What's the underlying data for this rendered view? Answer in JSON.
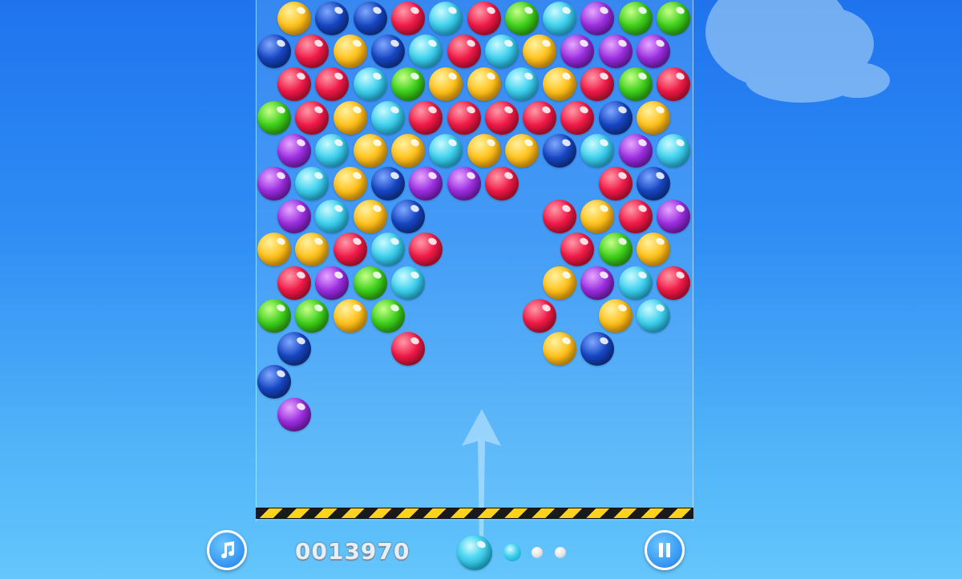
{
  "game": {
    "score": "0013970",
    "music_button_icon": "music-note-icon",
    "pause_button_icon": "pause-icon",
    "next_queue": [
      "cyan",
      "white",
      "white"
    ],
    "current_bubble": "cyan"
  },
  "colors": {
    "yellow": [
      "#fff2a0",
      "#ffc21e",
      "#d98a00"
    ],
    "navy": [
      "#7fa9ff",
      "#1746c4",
      "#0b2a7a"
    ],
    "red": [
      "#ff9aa8",
      "#f01a47",
      "#a80a28"
    ],
    "cyan": [
      "#c9fbff",
      "#3ed0ee",
      "#0e93bd"
    ],
    "green": [
      "#c8ff8a",
      "#3ed01c",
      "#1f8a0a"
    ],
    "purple": [
      "#e7a8ff",
      "#9b2ee0",
      "#5e1196"
    ],
    "white": [
      "#ffffff",
      "#e3e3e3",
      "#a9a9a9"
    ]
  },
  "grid": {
    "rows": [
      [
        "yellow",
        "navy",
        "navy",
        "red",
        "cyan",
        "red",
        "green",
        "cyan",
        "purple",
        "green",
        "green"
      ],
      [
        "navy",
        "red",
        "yellow",
        "navy",
        "cyan",
        "red",
        "cyan",
        "yellow",
        "purple",
        "purple",
        "purple"
      ],
      [
        "red",
        "red",
        "cyan",
        "green",
        "yellow",
        "yellow",
        "cyan",
        "yellow",
        "red",
        "green",
        "red"
      ],
      [
        "green",
        "red",
        "yellow",
        "cyan",
        "red",
        "red",
        "red",
        "red",
        "red",
        "navy",
        "yellow"
      ],
      [
        "purple",
        "cyan",
        "yellow",
        "yellow",
        "cyan",
        "yellow",
        "yellow",
        "navy",
        "cyan",
        "purple",
        "cyan"
      ],
      [
        "purple",
        "cyan",
        "yellow",
        "navy",
        "purple",
        "purple",
        "red",
        null,
        null,
        "red",
        "navy"
      ],
      [
        "purple",
        "cyan",
        "yellow",
        "navy",
        null,
        null,
        null,
        "red",
        "yellow",
        "red",
        "purple"
      ],
      [
        "yellow",
        "yellow",
        "red",
        "cyan",
        "red",
        null,
        null,
        null,
        "red",
        "green",
        "yellow"
      ],
      [
        "red",
        "purple",
        "green",
        "cyan",
        null,
        null,
        null,
        "yellow",
        "purple",
        "cyan",
        "red"
      ],
      [
        "green",
        "green",
        "yellow",
        "green",
        null,
        null,
        null,
        "red",
        null,
        "yellow",
        "cyan"
      ],
      [
        "navy",
        null,
        null,
        "red",
        null,
        null,
        null,
        "yellow",
        "navy",
        null,
        null
      ],
      [
        "navy",
        null,
        null,
        null,
        null,
        null,
        null,
        null,
        null,
        null,
        null
      ],
      [
        "purple",
        null,
        null,
        null,
        null,
        null,
        null,
        null,
        null,
        null,
        null
      ]
    ]
  }
}
